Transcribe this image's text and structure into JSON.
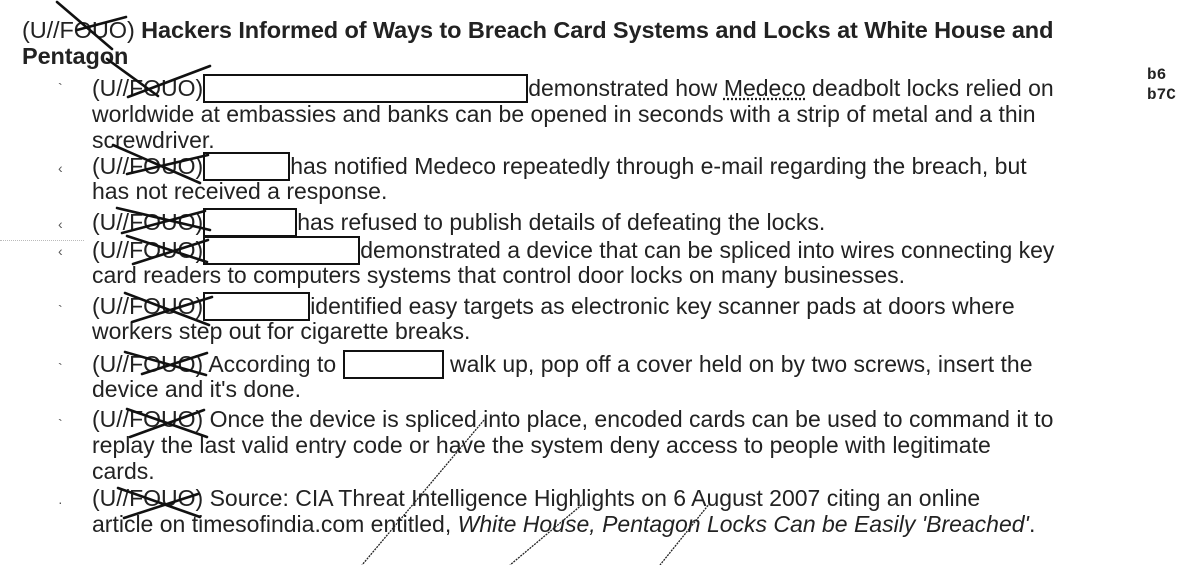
{
  "document": {
    "classification_marking": "(U//FOUO)",
    "marking_prefix": "(U//",
    "marking_struck": "FOUO",
    "marking_suffix": ")",
    "title_text": "Hackers Informed of Ways to Breach Card Systems and Locks at White House and",
    "title_text_line2": "Pentagon",
    "exemptions": [
      "b6",
      "b7C"
    ],
    "bullets": [
      {
        "lines": [
          {
            "before": "",
            "after_redaction": "demonstrated how ",
            "underlined": "Medeco",
            "rest": " deadbolt locks relied on"
          },
          {
            "text": "worldwide at embassies and banks can be opened in seconds with a strip of metal and a thin"
          },
          {
            "text": "screwdriver."
          }
        ]
      },
      {
        "lines": [
          {
            "after_redaction": "has notified Medeco repeatedly through e-mail regarding the breach, but"
          },
          {
            "text": "has not received a response."
          }
        ]
      },
      {
        "lines": [
          {
            "after_redaction": "has refused to publish details of defeating the locks."
          }
        ]
      },
      {
        "lines": [
          {
            "after_redaction": "demonstrated a device that can be spliced into wires connecting key"
          },
          {
            "text": "card readers to computers systems that control door locks on many businesses."
          }
        ]
      },
      {
        "lines": [
          {
            "after_redaction": "identified easy targets as electronic key scanner pads at doors where"
          },
          {
            "text": "workers step out for cigarette breaks."
          }
        ]
      },
      {
        "lines": [
          {
            "before_redaction": "According to",
            "after_redaction": " walk up, pop off a cover held on by two screws, insert the"
          },
          {
            "text": "device and it's done."
          }
        ]
      },
      {
        "lines": [
          {
            "text_after_marking": "Once the device is spliced into place, encoded cards can be used to command it to"
          },
          {
            "text": "replay the last valid entry code or have the system deny access to people with legitimate"
          },
          {
            "text": "cards."
          }
        ]
      },
      {
        "lines": [
          {
            "text_after_marking": "Source:  CIA Threat Intelligence Highlights on 6 August 2007 citing an online"
          },
          {
            "text": "article on timesofindia.com entitled, ",
            "italic": "White House, Pentagon Locks Can be Easily 'Breached'",
            "end": "."
          }
        ]
      }
    ]
  }
}
